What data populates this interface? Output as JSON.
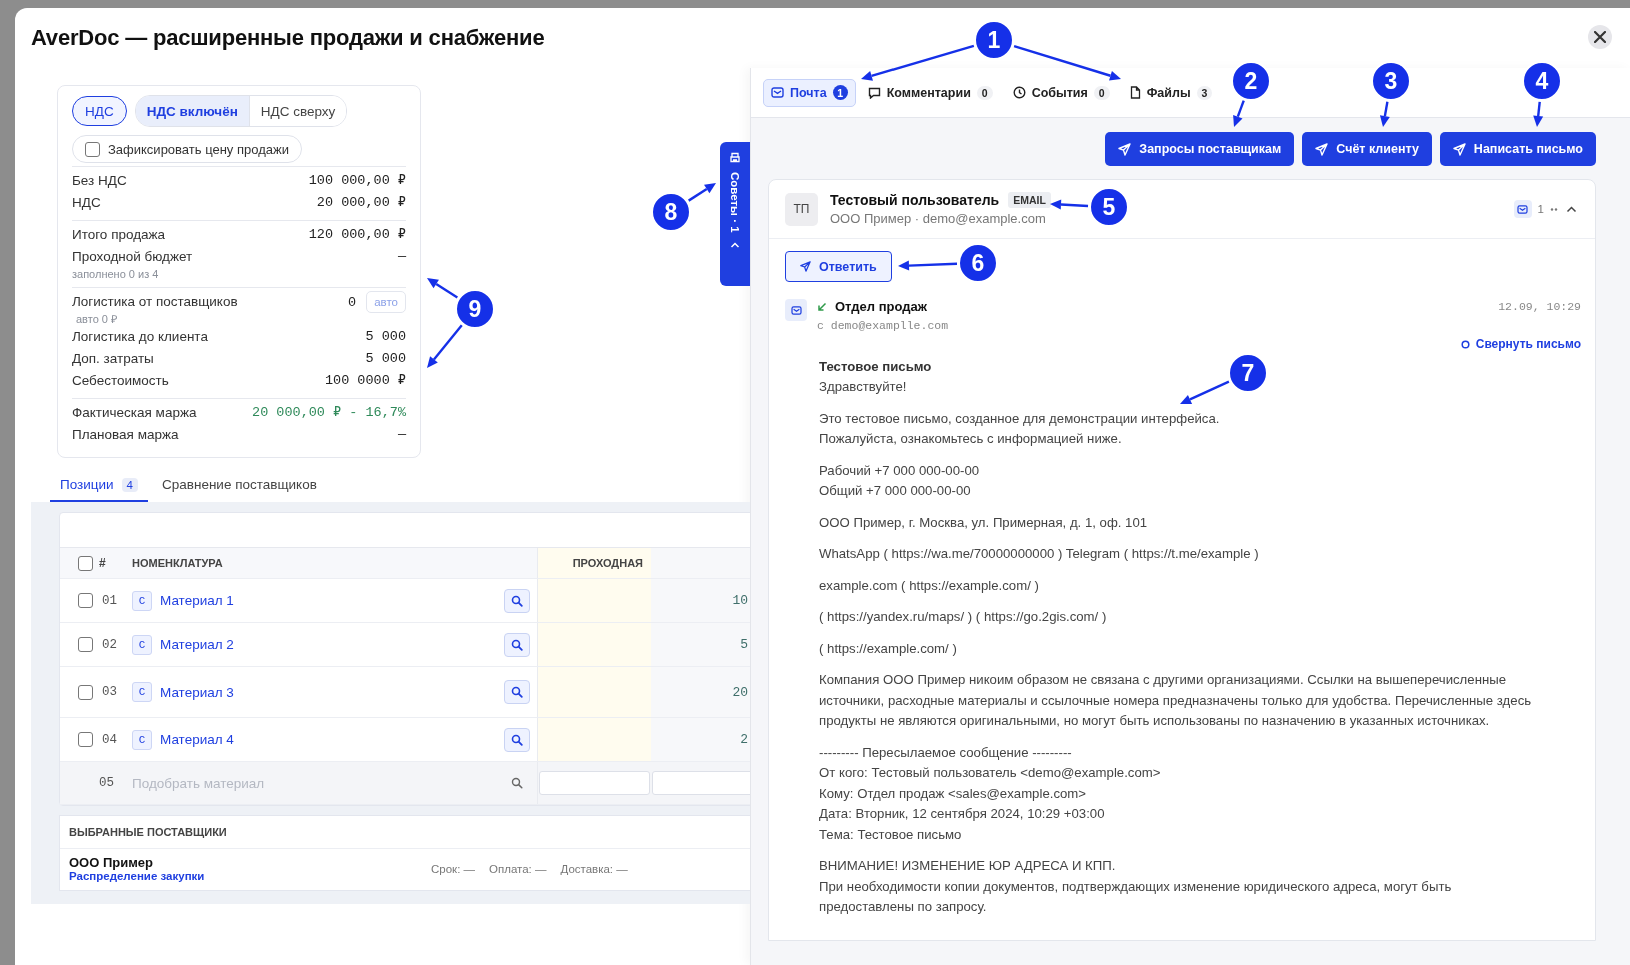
{
  "window": {
    "title": "AverDoc — расширенные продажи и снабжение"
  },
  "summary": {
    "vat_toggle": {
      "label": "НДС",
      "on": true
    },
    "vat_modes": [
      {
        "label": "НДС включён",
        "selected": true
      },
      {
        "label": "НДС сверху",
        "selected": false
      }
    ],
    "fix_price": {
      "label": "Зафиксировать цену продажи",
      "checked": false
    },
    "groups": [
      {
        "rows": [
          {
            "label": "Без НДС",
            "value": "100 000,00 ₽"
          },
          {
            "label": "НДС",
            "value": "20 000,00 ₽"
          }
        ]
      },
      {
        "rows": [
          {
            "label": "Итого продажа",
            "value": "120 000,00 ₽"
          },
          {
            "label": "Проходной бюджет",
            "value": "—",
            "note": "заполнено 0 из 4"
          }
        ]
      },
      {
        "rows": [
          {
            "label": "Логистика от поставщиков",
            "value": "0",
            "note": "авто 0 ₽",
            "action": "авто"
          },
          {
            "label": "Логистика до клиента",
            "value": "5 000"
          },
          {
            "label": "Доп. затраты",
            "value": "5 000"
          },
          {
            "label": "Себестоимость",
            "value": "100 0000 ₽"
          }
        ]
      },
      {
        "rows": [
          {
            "label": "Фактическая маржа",
            "value": "20 000,00 ₽ - 16,7%",
            "color": "#2f8a5a"
          },
          {
            "label": "Плановая маржа",
            "value": "—"
          }
        ]
      }
    ]
  },
  "side_tab": {
    "label": "Советы · 1"
  },
  "tabs": [
    {
      "label": "Позиции",
      "count": "4",
      "selected": true
    },
    {
      "label": "Сравнение поставщиков",
      "selected": false
    }
  ],
  "table": {
    "all_checked": false,
    "columns": [
      "#",
      "НОМЕНКЛАТУРА",
      "ПРОХОДНАЯ"
    ],
    "rows": [
      {
        "number": "01",
        "type": "С",
        "name": "Материал 1",
        "column_3": "10",
        "checked": false
      },
      {
        "number": "02",
        "type": "С",
        "name": "Материал 2",
        "column_3": "5",
        "checked": false
      },
      {
        "number": "03",
        "type": "С",
        "name": "Материал 3",
        "column_3": "20",
        "checked": false
      },
      {
        "number": "04",
        "type": "С",
        "name": "Материал 4",
        "column_3": "2",
        "checked": false
      }
    ],
    "new_row": {
      "number": "05",
      "placeholder": "Подобрать материал"
    }
  },
  "suppliers": {
    "title": "ВЫБРАННЫЕ ПОСТАВЩИКИ",
    "items": [
      {
        "name": "ООО Пример",
        "link": "Распределение закупки",
        "term": "Срок: —",
        "payment": "Оплата: —",
        "delivery": "Доставка: —"
      }
    ]
  },
  "feed_tabs": [
    {
      "label": "Почта",
      "count": "1",
      "selected": true
    },
    {
      "label": "Комментарии",
      "count": "0",
      "selected": false
    },
    {
      "label": "События",
      "count": "0",
      "selected": false
    },
    {
      "label": "Файлы",
      "count": "3",
      "selected": false
    }
  ],
  "actions": [
    "Запросы поставщикам",
    "Счёт клиенту",
    "Написать письмо"
  ],
  "thread": {
    "initials": "ТП",
    "name": "Тестовый пользователь",
    "badge": "EMAIL",
    "subtitle": "ООО Пример · demo@example.com",
    "count": "1",
    "expanded": true,
    "reply": "Ответить",
    "message": {
      "sender": "Отдел продаж",
      "from": "с demo@examplle.com",
      "time": "12.09, 10:29",
      "collapse": "Свернуть письмо",
      "subject": "Тестовое письмо",
      "paragraphs": [
        [
          "Здравствуйте!"
        ],
        [
          "Это тестовое письмо, созданное для демонстрации интерфейса.",
          "Пожалуйста, ознакомьтесь с информацией ниже."
        ],
        [
          "Рабочий +7 000 000-00-00",
          "Общий +7 000 000-00-00"
        ],
        [
          "ООО Пример, г. Москва, ул. Примерная, д. 1, оф. 101"
        ],
        [
          "WhatsApp ( https://wa.me/70000000000 ) Telegram ( https://t.me/example )"
        ],
        [
          "example.com ( https://example.com/ )"
        ],
        [
          "( https://yandex.ru/maps/ ) ( https://go.2gis.com/ )"
        ],
        [
          "( https://example.com/ )"
        ],
        [
          "Компания ООО Пример никоим образом не связана с другими организациями. Ссылки на вышеперечисленные источники, расходные материалы и ссылочные номера предназначены только для удобства. Перечисленные здесь продукты не являются оригинальными, но могут быть использованы по назначению в указанных источниках."
        ],
        [
          "--------- Пересылаемое сообщение ---------",
          "От кого: Тестовый пользователь <demo@example.com>",
          "Кому: Отдел продаж <sales@example.com>",
          "Дата: Вторник, 12 сентября 2024, 10:29 +03:00",
          "Тема: Тестовое письмо"
        ],
        [
          "ВНИМАНИЕ! ИЗМЕНЕНИЕ ЮР АДРЕСА И КПП.",
          "При необходимости копии документов, подтверждающих изменение юридического адреса, могут быть предоставлены по запросу."
        ]
      ]
    }
  },
  "callouts": [
    {
      "label": "1"
    },
    {
      "label": "2"
    },
    {
      "label": "3"
    },
    {
      "label": "4"
    },
    {
      "label": "5"
    },
    {
      "label": "6"
    },
    {
      "label": "7"
    },
    {
      "label": "8"
    },
    {
      "label": "9"
    }
  ]
}
